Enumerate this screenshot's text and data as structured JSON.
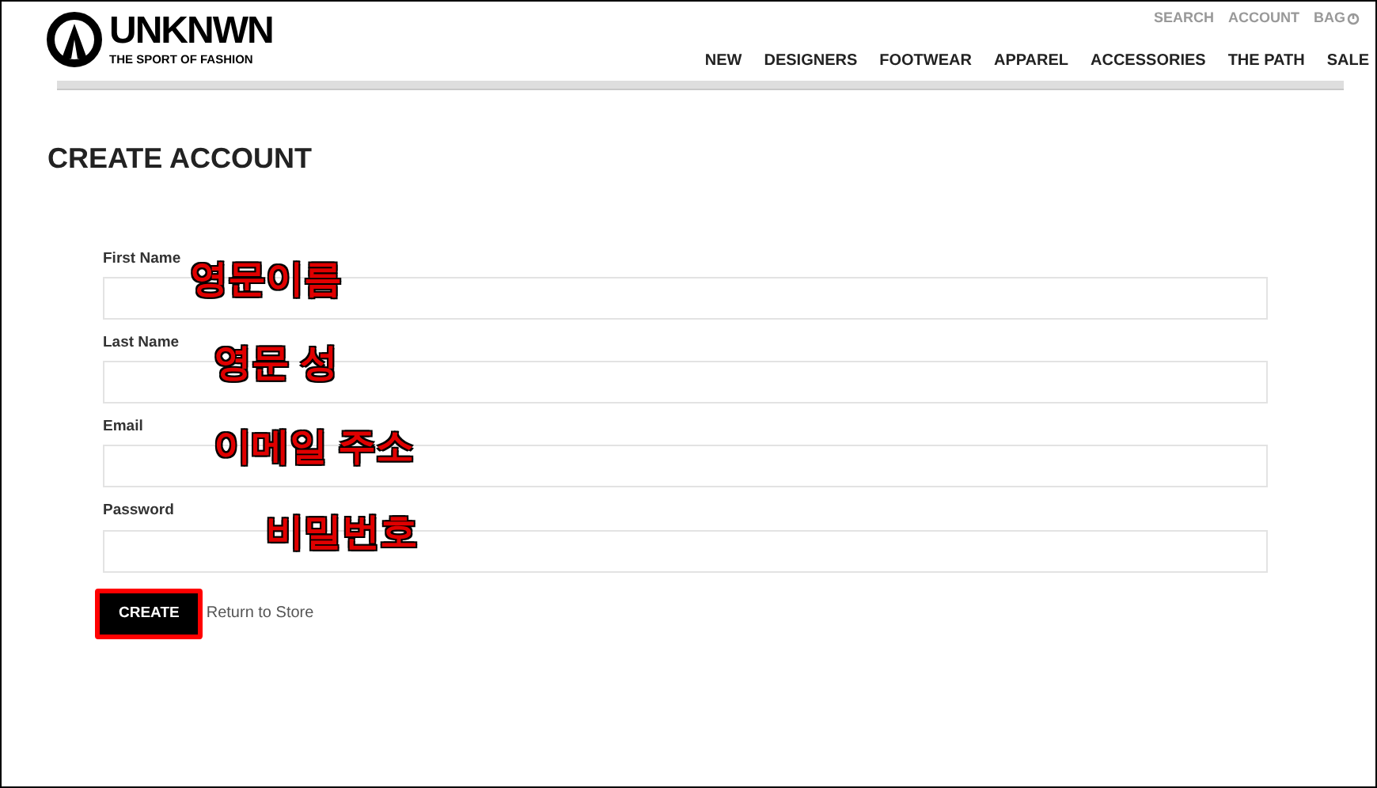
{
  "logo": {
    "name": "UNKNWN",
    "tagline": "THE SPORT OF FASHION"
  },
  "top_links": [
    "SEARCH",
    "ACCOUNT",
    "BAG"
  ],
  "nav": [
    "NEW",
    "DESIGNERS",
    "FOOTWEAR",
    "APPAREL",
    "ACCESSORIES",
    "THE PATH",
    "SALE"
  ],
  "title": "CREATE ACCOUNT",
  "fields": [
    {
      "label": "First Name",
      "annotation": "영문이름"
    },
    {
      "label": "Last Name",
      "annotation": "영문 성"
    },
    {
      "label": "Email",
      "annotation": "이메일 주소"
    },
    {
      "label": "Password",
      "annotation": "비밀번호"
    }
  ],
  "submit": {
    "label": "CREATE",
    "highlighted": true
  },
  "return_link": "Return to Store"
}
